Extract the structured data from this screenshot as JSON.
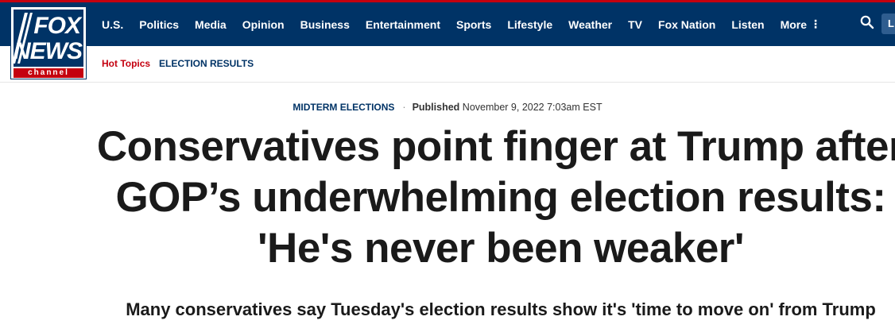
{
  "brand": {
    "logo_line1": "FOX",
    "logo_line2": "NEWS",
    "logo_line3": "channel",
    "primary_color": "#003366",
    "accent_color": "#c4000f"
  },
  "nav": {
    "items": [
      {
        "label": "U.S."
      },
      {
        "label": "Politics"
      },
      {
        "label": "Media"
      },
      {
        "label": "Opinion"
      },
      {
        "label": "Business"
      },
      {
        "label": "Entertainment"
      },
      {
        "label": "Sports"
      },
      {
        "label": "Lifestyle"
      },
      {
        "label": "Weather"
      },
      {
        "label": "TV"
      },
      {
        "label": "Fox Nation"
      },
      {
        "label": "Listen"
      },
      {
        "label": "More"
      }
    ],
    "more_icon": "vertical-dots-icon",
    "search_icon": "search-icon",
    "login_label": "L"
  },
  "subnav": {
    "hot_topics": "Hot Topics",
    "link": "ELECTION RESULTS"
  },
  "article": {
    "eyebrow": "MIDTERM ELECTIONS",
    "published_label": "Published",
    "published_date": "November 9, 2022 7:03am EST",
    "headline": "Conservatives point finger at Trump after GOP’s underwhelming election results: 'He's never been weaker'",
    "subhead": "Many conservatives say Tuesday's election results show it's 'time to move on' from Trump"
  }
}
